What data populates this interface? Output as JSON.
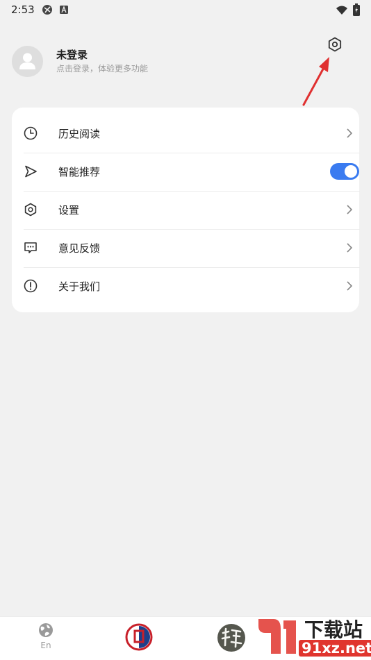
{
  "status_bar": {
    "time": "2:53"
  },
  "profile": {
    "name": "未登录",
    "subtitle": "点击登录，体验更多功能"
  },
  "menu": [
    {
      "label": "历史阅读",
      "icon": "clock-icon"
    },
    {
      "label": "智能推荐",
      "icon": "send-icon",
      "toggle_on": true
    },
    {
      "label": "设置",
      "icon": "settings-icon"
    },
    {
      "label": "意见反馈",
      "icon": "feedback-icon"
    },
    {
      "label": "关于我们",
      "icon": "info-icon"
    }
  ],
  "bottom_nav": {
    "tab1_label": "En"
  },
  "watermark": {
    "brand": "下载站",
    "domain": "91xz.net"
  },
  "colors": {
    "accent": "#3a7bf0",
    "annotation_arrow": "#e03030"
  }
}
